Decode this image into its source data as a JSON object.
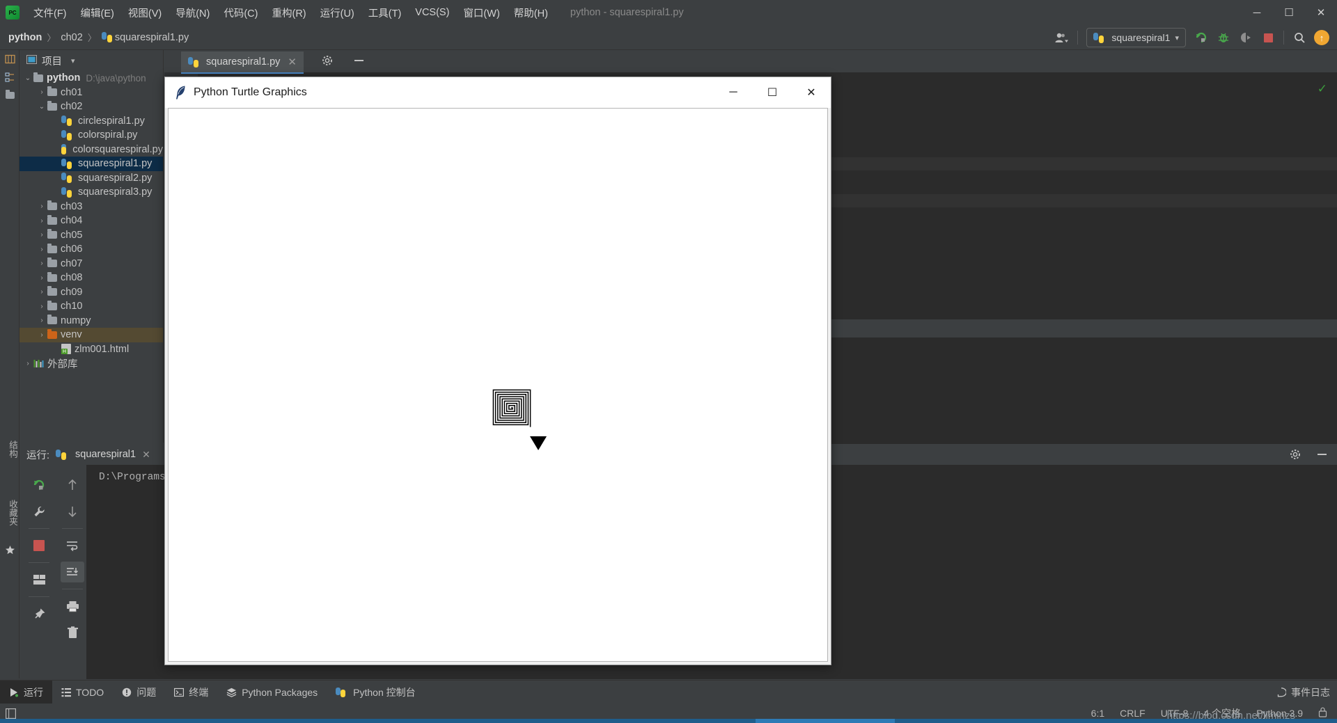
{
  "app": {
    "window_title": "python - squarespiral1.py",
    "logo": "pycharm-logo"
  },
  "menubar": {
    "items": [
      {
        "label": "文件(F)",
        "name": "menu-file"
      },
      {
        "label": "编辑(E)",
        "name": "menu-edit"
      },
      {
        "label": "视图(V)",
        "name": "menu-view"
      },
      {
        "label": "导航(N)",
        "name": "menu-navigate"
      },
      {
        "label": "代码(C)",
        "name": "menu-code"
      },
      {
        "label": "重构(R)",
        "name": "menu-refactor"
      },
      {
        "label": "运行(U)",
        "name": "menu-run"
      },
      {
        "label": "工具(T)",
        "name": "menu-tools"
      },
      {
        "label": "VCS(S)",
        "name": "menu-vcs"
      },
      {
        "label": "窗口(W)",
        "name": "menu-window"
      },
      {
        "label": "帮助(H)",
        "name": "menu-help"
      }
    ],
    "window_controls": {
      "minimize": "─",
      "maximize": "☐",
      "close": "✕"
    }
  },
  "breadcrumb": {
    "project": "python",
    "folder": "ch02",
    "file": "squarespiral1.py",
    "separator": "〉"
  },
  "toolbar": {
    "run_config_name": "squarespiral1",
    "dropdown_caret": "▾",
    "run_icon": "run-icon",
    "debug_icon": "debug-icon",
    "coverage_icon": "run-with-coverage-icon",
    "stop_icon": "stop-icon",
    "search_icon": "search-icon",
    "update_icon": "update-project-icon",
    "account_icon": "account-icon"
  },
  "left_strip": {
    "items": [
      {
        "label": "项目",
        "name": "strip-project"
      },
      {
        "label": "结构",
        "name": "strip-structure"
      },
      {
        "label": "收藏夹",
        "name": "strip-favorites"
      }
    ]
  },
  "project_panel": {
    "title": "项目",
    "caret": "▾",
    "tree": [
      {
        "depth": 0,
        "chev": "⌄",
        "label": "python",
        "path": "D:\\java\\python",
        "type": "folder",
        "bold": true,
        "state": "normal"
      },
      {
        "depth": 1,
        "chev": "›",
        "label": "ch01",
        "type": "folder",
        "state": "normal"
      },
      {
        "depth": 1,
        "chev": "⌄",
        "label": "ch02",
        "type": "folder",
        "state": "normal"
      },
      {
        "depth": 2,
        "chev": "",
        "label": "circlespiral1.py",
        "type": "python",
        "state": "normal"
      },
      {
        "depth": 2,
        "chev": "",
        "label": "colorspiral.py",
        "type": "python",
        "state": "normal"
      },
      {
        "depth": 2,
        "chev": "",
        "label": "colorsquarespiral.py",
        "type": "python",
        "state": "normal"
      },
      {
        "depth": 2,
        "chev": "",
        "label": "squarespiral1.py",
        "type": "python",
        "state": "selected"
      },
      {
        "depth": 2,
        "chev": "",
        "label": "squarespiral2.py",
        "type": "python",
        "state": "normal"
      },
      {
        "depth": 2,
        "chev": "",
        "label": "squarespiral3.py",
        "type": "python",
        "state": "normal"
      },
      {
        "depth": 1,
        "chev": "›",
        "label": "ch03",
        "type": "folder",
        "state": "normal"
      },
      {
        "depth": 1,
        "chev": "›",
        "label": "ch04",
        "type": "folder",
        "state": "normal"
      },
      {
        "depth": 1,
        "chev": "›",
        "label": "ch05",
        "type": "folder",
        "state": "normal"
      },
      {
        "depth": 1,
        "chev": "›",
        "label": "ch06",
        "type": "folder",
        "state": "normal"
      },
      {
        "depth": 1,
        "chev": "›",
        "label": "ch07",
        "type": "folder",
        "state": "normal"
      },
      {
        "depth": 1,
        "chev": "›",
        "label": "ch08",
        "type": "folder",
        "state": "normal"
      },
      {
        "depth": 1,
        "chev": "›",
        "label": "ch09",
        "type": "folder",
        "state": "normal"
      },
      {
        "depth": 1,
        "chev": "›",
        "label": "ch10",
        "type": "folder",
        "state": "normal"
      },
      {
        "depth": 1,
        "chev": "›",
        "label": "numpy",
        "type": "folder",
        "state": "normal"
      },
      {
        "depth": 1,
        "chev": "›",
        "label": "venv",
        "type": "folder-orange",
        "state": "highlight"
      },
      {
        "depth": 2,
        "chev": "",
        "label": "zlm001.html",
        "type": "html",
        "state": "normal"
      },
      {
        "depth": 0,
        "chev": "›",
        "label": "外部库",
        "type": "library",
        "state": "normal"
      }
    ]
  },
  "editor": {
    "tab_label": "squarespiral1.py",
    "tab_close": "✕",
    "inspection_icon": "inspection-ok-icon"
  },
  "run_panel": {
    "label": "运行:",
    "tab_name": "squarespiral1",
    "tab_close": "✕",
    "console_text": "D:\\Programs\\",
    "settings_icon": "gear-icon",
    "hide_icon": "hide-icon",
    "buttons": [
      {
        "name": "rerun-button",
        "icon": "rerun-icon"
      },
      {
        "name": "run-settings-button",
        "icon": "wrench-icon"
      },
      {
        "name": "stop-button",
        "icon": "stop-square-icon"
      },
      {
        "name": "layout-button",
        "icon": "layout-icon"
      },
      {
        "name": "pin-button",
        "icon": "pin-icon"
      }
    ],
    "buttons2": [
      {
        "name": "up-stack-button",
        "icon": "arrow-up-icon"
      },
      {
        "name": "down-stack-button",
        "icon": "arrow-down-icon"
      },
      {
        "name": "soft-wrap-button",
        "icon": "soft-wrap-icon"
      },
      {
        "name": "scroll-to-end-button",
        "icon": "scroll-end-icon"
      },
      {
        "name": "print-button",
        "icon": "print-icon"
      },
      {
        "name": "clear-all-button",
        "icon": "trash-icon"
      }
    ]
  },
  "bottom_bar": {
    "items": [
      {
        "label": "运行",
        "name": "tool-run",
        "icon": "play-icon",
        "active": true
      },
      {
        "label": "TODO",
        "name": "tool-todo",
        "icon": "todo-icon",
        "active": false
      },
      {
        "label": "问题",
        "name": "tool-problems",
        "icon": "problems-icon",
        "active": false
      },
      {
        "label": "终端",
        "name": "tool-terminal",
        "icon": "terminal-icon",
        "active": false
      },
      {
        "label": "Python Packages",
        "name": "tool-python-packages",
        "icon": "packages-icon",
        "active": false
      },
      {
        "label": "Python 控制台",
        "name": "tool-python-console",
        "icon": "python-icon",
        "active": false
      }
    ],
    "event_log": {
      "label": "事件日志",
      "icon": "event-log-icon"
    }
  },
  "status_bar": {
    "left_icon": "show-tool-windows-icon",
    "caret_position": "6:1",
    "line_separator": "CRLF",
    "encoding": "UTF-8",
    "indent": "4 个空格",
    "interpreter": "Python 3.9",
    "lock_icon": "lock-icon",
    "watermark": "https://blog.csdn.net/liminzs"
  },
  "turtle_window": {
    "title": "Python Turtle Graphics",
    "icon": "feather-icon",
    "controls": {
      "minimize": "─",
      "maximize": "☐",
      "close": "✕"
    },
    "canvas_bg": "#ffffff",
    "drawing": {
      "type": "square-spiral",
      "turns": 16,
      "stroke": "#000000",
      "turtle_cursor": "arrow"
    }
  },
  "colors": {
    "accent": "#4a88c7",
    "ide_bg": "#3c3f41",
    "editor_bg": "#2b2b2b",
    "selection": "#0d2c47",
    "highlight": "#544a32",
    "run_green": "#3c9e3c",
    "stop_red": "#c75450",
    "update_orange": "#f0a732"
  }
}
